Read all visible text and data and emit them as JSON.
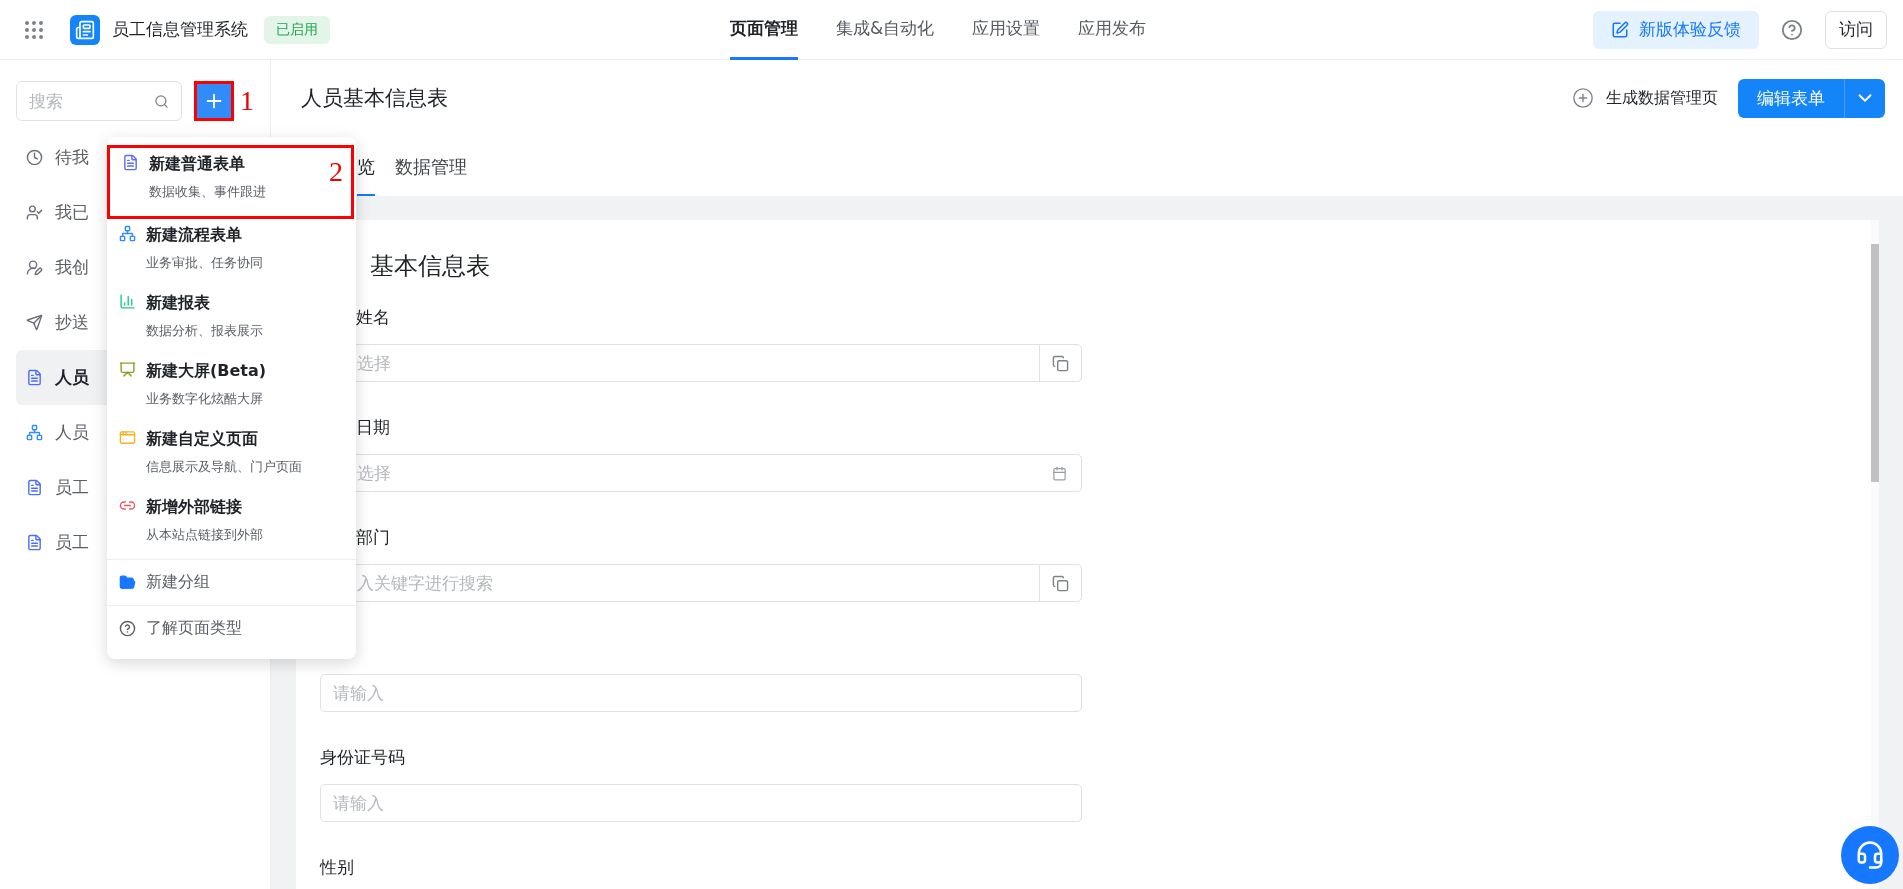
{
  "topbar": {
    "app_name": "员工信息管理系统",
    "status": "已启用",
    "feedback": "新版体验反馈",
    "visit": "访问",
    "nav": [
      {
        "label": "页面管理",
        "selected": true
      },
      {
        "label": "集成&自动化",
        "selected": false
      },
      {
        "label": "应用设置",
        "selected": false
      },
      {
        "label": "应用发布",
        "selected": false
      }
    ]
  },
  "sidebar": {
    "search_placeholder": "搜索",
    "items": [
      {
        "label": "待我",
        "kind": "clock",
        "selected": false
      },
      {
        "label": "我已",
        "kind": "done",
        "selected": false
      },
      {
        "label": "我创",
        "kind": "created",
        "selected": false
      },
      {
        "label": "抄送",
        "kind": "send",
        "selected": false
      },
      {
        "label": "人员",
        "kind": "form",
        "selected": true
      },
      {
        "label": "人员",
        "kind": "flow",
        "selected": false
      },
      {
        "label": "员工",
        "kind": "form",
        "selected": false
      },
      {
        "label": "员工",
        "kind": "form",
        "selected": false
      }
    ]
  },
  "menu": {
    "items": [
      {
        "title": "新建普通表单",
        "subtitle": "数据收集、事件跟进",
        "kind": "form"
      },
      {
        "title": "新建流程表单",
        "subtitle": "业务审批、任务协同",
        "kind": "flow"
      },
      {
        "title": "新建报表",
        "subtitle": "数据分析、报表展示",
        "kind": "report"
      },
      {
        "title": "新建大屏(Beta)",
        "subtitle": "业务数字化炫酷大屏",
        "kind": "screen"
      },
      {
        "title": "新建自定义页面",
        "subtitle": "信息展示及导航、门户页面",
        "kind": "custom"
      },
      {
        "title": "新增外部链接",
        "subtitle": "从本站点链接到外部",
        "kind": "link"
      }
    ],
    "footer": [
      {
        "label": "新建分组",
        "kind": "group"
      },
      {
        "label": "了解页面类型",
        "kind": "help"
      }
    ]
  },
  "annotations": [
    {
      "label": "1"
    },
    {
      "label": "2"
    }
  ],
  "page": {
    "title": "人员基本信息表",
    "generate": "生成数据管理页",
    "edit": "编辑表单",
    "tabs": [
      {
        "label": "览",
        "selected": true
      },
      {
        "label": "数据管理",
        "selected": false
      }
    ],
    "form": {
      "title": "基本信息表",
      "fields": [
        {
          "label": "姓名",
          "placeholder": "选择",
          "kind": "picker"
        },
        {
          "label": "日期",
          "placeholder": "选择",
          "kind": "date"
        },
        {
          "label": "部门",
          "placeholder": "入关键字进行搜索",
          "kind": "picker"
        },
        {
          "placeholder": "请输入",
          "kind": "text"
        },
        {
          "label": "身份证号码",
          "placeholder": "请输入",
          "kind": "text"
        },
        {
          "label": "性别"
        }
      ]
    }
  }
}
